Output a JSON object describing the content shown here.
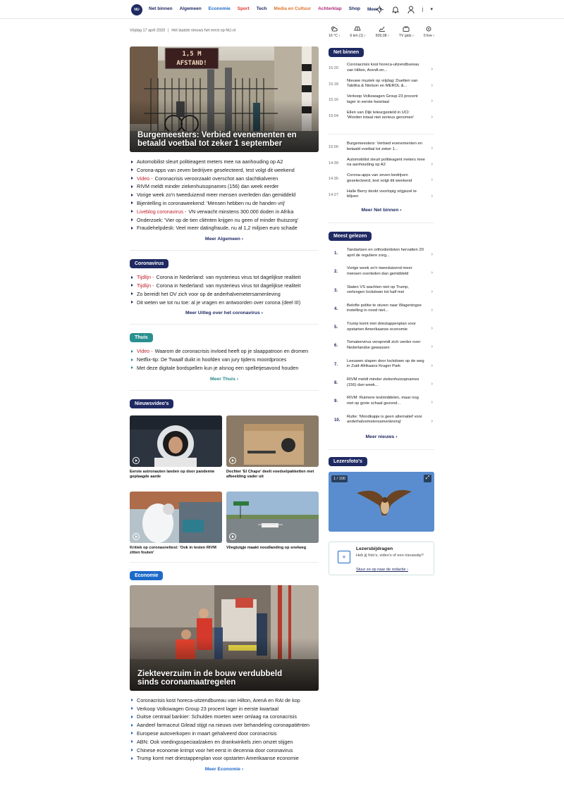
{
  "nav": {
    "logo_text": "NU",
    "items": [
      {
        "label": "Net binnen",
        "color": "#1f2a63"
      },
      {
        "label": "Algemeen",
        "color": "#1f2a63"
      },
      {
        "label": "Economie",
        "color": "#1c69c9"
      },
      {
        "label": "Sport",
        "color": "#e5342b"
      },
      {
        "label": "Tech",
        "color": "#1f2a63"
      },
      {
        "label": "Media en Cultuur",
        "color": "#e0742a"
      },
      {
        "label": "Achterklap",
        "color": "#b12a7a"
      },
      {
        "label": "Shop",
        "color": "#1f2a63"
      },
      {
        "label": "Meer ▾",
        "color": "#1f2a63"
      }
    ],
    "user_initial": "j"
  },
  "dateline": {
    "date": "Vrijdag 17 april 2020",
    "tagline": "Het laatste nieuws het eerst op NU.nl"
  },
  "hero": {
    "title": "Burgemeesters: Verbied evenementen en betaald voetbal tot zeker 1 september",
    "sign_text": "1,5 M AFSTAND!"
  },
  "algemeen": {
    "headlines": [
      {
        "tag": "",
        "text": "Automobilist sleurt politieagent meters mee na aanhouding op A2"
      },
      {
        "tag": "",
        "text": "Corona-apps van zeven bedrijven geselecteerd, test volgt dit weekend"
      },
      {
        "tag": "Video -",
        "text": "Coronacrisis veroorzaakt overschot aan slachtkalveren"
      },
      {
        "tag": "",
        "text": "RIVM meldt minder ziekenhuisopnames (156) dan week eerder"
      },
      {
        "tag": "",
        "text": "Vorige week zo'n tweeduizend meer mensen overleden dan gemiddeld"
      },
      {
        "tag": "",
        "text": "Bijentelling in coronaweekend: 'Mensen hebben nu de handen vrij'"
      },
      {
        "tag": "Liveblog coronavirus -",
        "text": "VN verwacht minstens 300.000 doden in Afrika"
      },
      {
        "tag": "",
        "text": "Onderzoek: 'Vier op de tien cliënten krijgen nu geen of minder thuiszorg'"
      },
      {
        "tag": "",
        "text": "Fraudehelpdesk: Veel meer datingfraude, nu al 1,2 miljoen euro schade"
      }
    ],
    "more": "Meer Algemeen ›"
  },
  "coronavirus": {
    "label": "Coronavirus",
    "headlines": [
      {
        "tag": "Tijdlijn -",
        "text": "Corona in Nederland: van mysterieus virus tot dagelijkse realiteit"
      },
      {
        "tag": "Tijdlijn -",
        "text": "Corona in Nederland: van mysterieus virus tot dagelijkse realiteit"
      },
      {
        "tag": "",
        "text": "Zo bereidt het OV zich voor op de anderhalvemetersamenleving"
      },
      {
        "tag": "",
        "text": "Dit weten we tot nu toe: al je vragen en antwoorden over corona (deel III)"
      }
    ],
    "more": "Meer Uitleg over het coronavirus ›"
  },
  "thuis": {
    "label": "Thuis",
    "headlines": [
      {
        "tag": "Video -",
        "text": "Waarom de coronacrisis invloed heeft op je slaappatroon en dromen"
      },
      {
        "tag": "",
        "text": "Netflix-tip: De Twaalf duikt in hoofden van jury tijdens moordproces"
      },
      {
        "tag": "",
        "text": "Met deze digitale bordspellen kun je alsnog een spelletjesavond houden"
      }
    ],
    "more": "Meer Thuis ›"
  },
  "videos": {
    "label": "Nieuwsvideo's",
    "items": [
      {
        "caption": "Eerste astronauten landen op door pandemie geplaagde aarde"
      },
      {
        "caption": "Dochter 'El Chapo' deelt voedselpakketten met afbeelding vader uit"
      },
      {
        "caption": "Kritiek op coronasneltest: 'Ook in testen RIVM zitten fouten'"
      },
      {
        "caption": "Vliegtuigje maakt noodlanding op snelweg"
      }
    ]
  },
  "economie": {
    "label": "Economie",
    "hero_title": "Ziekteverzuim in de bouw verdubbeld sinds coronamaatregelen",
    "headlines": [
      {
        "tag": "",
        "text": "Coronacrisis kost horeca-uitzendbureau van Hilton, ArenA en RAI de kop"
      },
      {
        "tag": "",
        "text": "Verkoop Volkswagen Group 23 procent lager in eerste kwartaal"
      },
      {
        "tag": "",
        "text": "Duitse centraal bankier: Schulden moeten weer omlaag na coronacrisis"
      },
      {
        "tag": "",
        "text": "Aandeel farmaceut Gilead stijgt na nieuws over behandeling coronapatiënten"
      },
      {
        "tag": "",
        "text": "Europese autoverkopen in maart gehalveerd door coronacrisis"
      },
      {
        "tag": "",
        "text": "ABN: Ook voedingsspeciaalzaken en drankwinkels zien omzet stijgen"
      },
      {
        "tag": "",
        "text": "Chinese economie krimpt voor het eerst in decennia door coronavirus"
      },
      {
        "tag": "",
        "text": "Trump komt met driestappenplan voor opstarten Amerikaanse economie"
      }
    ],
    "more": "Meer Economie ›"
  },
  "weather": [
    {
      "icon": "cloud-sun-icon",
      "label": "16 °C ›"
    },
    {
      "icon": "traffic-icon",
      "label": "6 km (1) ›"
    },
    {
      "icon": "chart-icon",
      "label": "509,08 ›"
    },
    {
      "icon": "tv-icon",
      "label": "TV gids ›"
    },
    {
      "icon": "live-icon",
      "label": "0 live ›"
    }
  ],
  "net_binnen": {
    "label": "Net binnen",
    "items_top": [
      {
        "time": "15:20",
        "text": "Coronacrisis kost horeca-uitzendbureau van Hilton, ArenA en..."
      },
      {
        "time": "15:18",
        "text": "Nieuwe muziek op vrijdag: Duetten van Tabitha & Nielson en MEROL &..."
      },
      {
        "time": "15:16",
        "text": "Verkoop Volkswagen Group 23 procent lager in eerste kwartaal"
      },
      {
        "time": "15:04",
        "text": "Ellen van Dijk teleurgesteld in UCI: 'Worden totaal niet serieus genomen'"
      }
    ],
    "items_bottom": [
      {
        "time": "15:00",
        "text": "Burgemeesters: Verbied evenementen en betaald voetbal tot zeker 1..."
      },
      {
        "time": "14:39",
        "text": "Automobilist sleurt politieagent meters mee na aanhouding op A2"
      },
      {
        "time": "14:35",
        "text": "Corona-apps van zeven bedrijven geselecteerd, test volgt dit weekend"
      },
      {
        "time": "14:27",
        "text": "Halle Berry denkt voorlopig vrijgezel te blijven"
      }
    ],
    "more": "Meer Net binnen ›"
  },
  "meest_gelezen": {
    "label": "Meest gelezen",
    "items": [
      {
        "num": "1.",
        "text": "Tandartsen en orthodontisten hervatten 20 april de reguliere zorg..."
      },
      {
        "num": "2.",
        "text": "Vorige week zo'n tweeduizend meer mensen overleden dan gemiddeld"
      },
      {
        "num": "3.",
        "text": "Staten VS wachten niet op Trump, verlengen lockdown tot half mei"
      },
      {
        "num": "4.",
        "text": "Belofte politie te sturen naar Wageningse instelling in nood niet..."
      },
      {
        "num": "5.",
        "text": "Trump komt met driestappenplan voor opstarten Amerikaanse economie"
      },
      {
        "num": "6.",
        "text": "Tomatenvirus verspreidt zich verder over Nederlandse gewassen"
      },
      {
        "num": "7.",
        "text": "Leeuwen slapen door lockdown op de weg in Zuid-Afrikaans Kruger Park"
      },
      {
        "num": "8.",
        "text": "RIVM meldt minder ziekenhuisopnames (156) dan week..."
      },
      {
        "num": "9.",
        "text": "RIVM: Ruimere testmiddelen, maar nog niet op grote schaal gezond..."
      },
      {
        "num": "10.",
        "text": "Rutte: 'Mondkapje is geen alternatief voor anderhalvemetersamenleving'"
      }
    ],
    "more": "Meer nieuws ›"
  },
  "lezersfotos": {
    "label": "Lezersfoto's",
    "counter": "1 / 100"
  },
  "lezersbijdragen": {
    "title": "Lezersbijdragen",
    "text": "Heb jij foto's, video's of een nieuwstip?",
    "link": "Stuur ze op naar de redactie ›"
  }
}
